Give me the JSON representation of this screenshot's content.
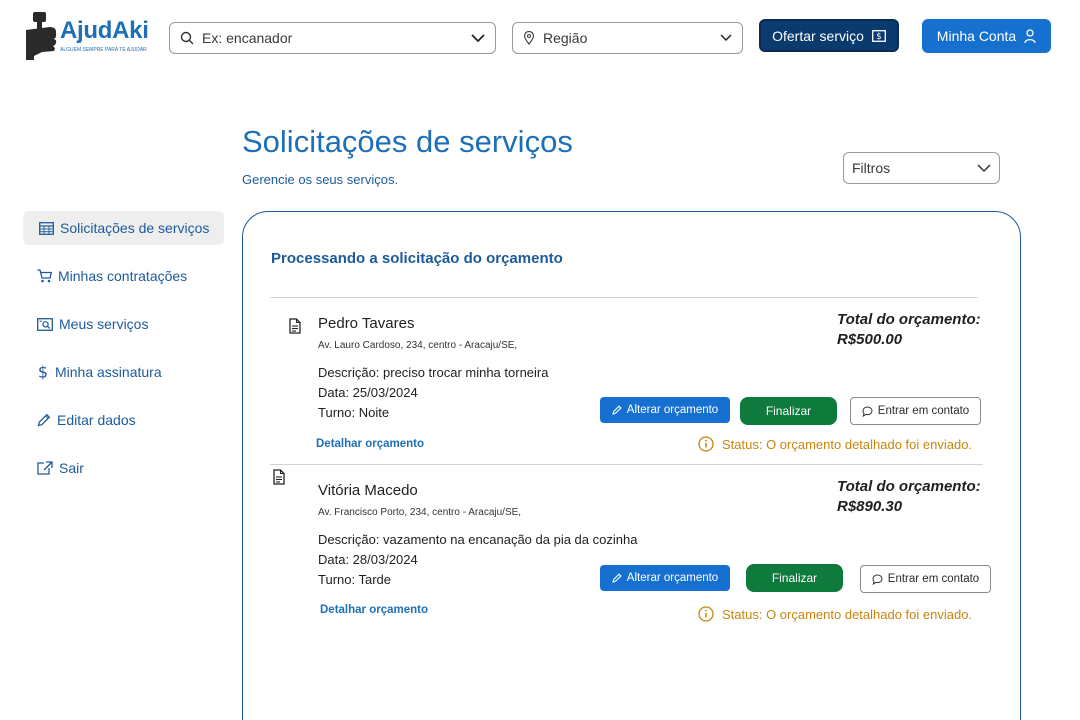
{
  "brand": {
    "name": "AjudAki",
    "tagline": "ALGUÉM SEMPRE PARA TE AJUDAR",
    "color": "#1d6fb8"
  },
  "header": {
    "search_placeholder": "Ex: encanador",
    "region_placeholder": "Região",
    "offer_label": "Ofertar serviço",
    "account_label": "Minha Conta"
  },
  "page": {
    "title": "Solicitações de serviços",
    "subtitle": "Gerencie os seus serviços.",
    "filter_label": "Filtros"
  },
  "sidebar": {
    "items": [
      {
        "label": "Solicitações de serviços",
        "icon": "calendar-icon",
        "active": true
      },
      {
        "label": "Minhas contratações",
        "icon": "cart-icon",
        "active": false
      },
      {
        "label": "Meus serviços",
        "icon": "search-document-icon",
        "active": false
      },
      {
        "label": "Minha assinatura",
        "icon": "dollar-icon",
        "active": false
      },
      {
        "label": "Editar dados",
        "icon": "pencil-icon",
        "active": false
      },
      {
        "label": "Sair",
        "icon": "external-link-icon",
        "active": false
      }
    ]
  },
  "panel": {
    "heading": "Processando a solicitação do orçamento",
    "requests": [
      {
        "name": "Pedro Tavares",
        "address": "Av. Lauro Cardoso, 234, centro - Aracaju/SE,",
        "description": "Descrição: preciso trocar minha torneira",
        "date": "Data: 25/03/2024",
        "shift": "Turno: Noite",
        "total_label": "Total do orçamento:",
        "total_value": "R$500.00",
        "alter_label": "Alterar orçamento",
        "finish_label": "Finalizar",
        "contact_label": "Entrar em contato",
        "detail_link": "Detalhar orçamento",
        "status": "Status: O orçamento detalhado foi enviado."
      },
      {
        "name": "Vitória Macedo",
        "address": "Av. Francisco Porto, 234, centro - Aracaju/SE,",
        "description": "Descrição: vazamento na encanação da pia da cozinha",
        "date": "Data: 28/03/2024",
        "shift": "Turno: Tarde",
        "total_label": "Total do orçamento:",
        "total_value": "R$890.30",
        "alter_label": "Alterar orçamento",
        "finish_label": "Finalizar",
        "contact_label": "Entrar em contato",
        "detail_link": "Detalhar orçamento",
        "status": "Status: O orçamento detalhado foi enviado."
      }
    ]
  },
  "colors": {
    "primary": "#1670d0",
    "navy": "#0b3a6e",
    "success": "#0e7a3c",
    "warning": "#c7850e"
  }
}
